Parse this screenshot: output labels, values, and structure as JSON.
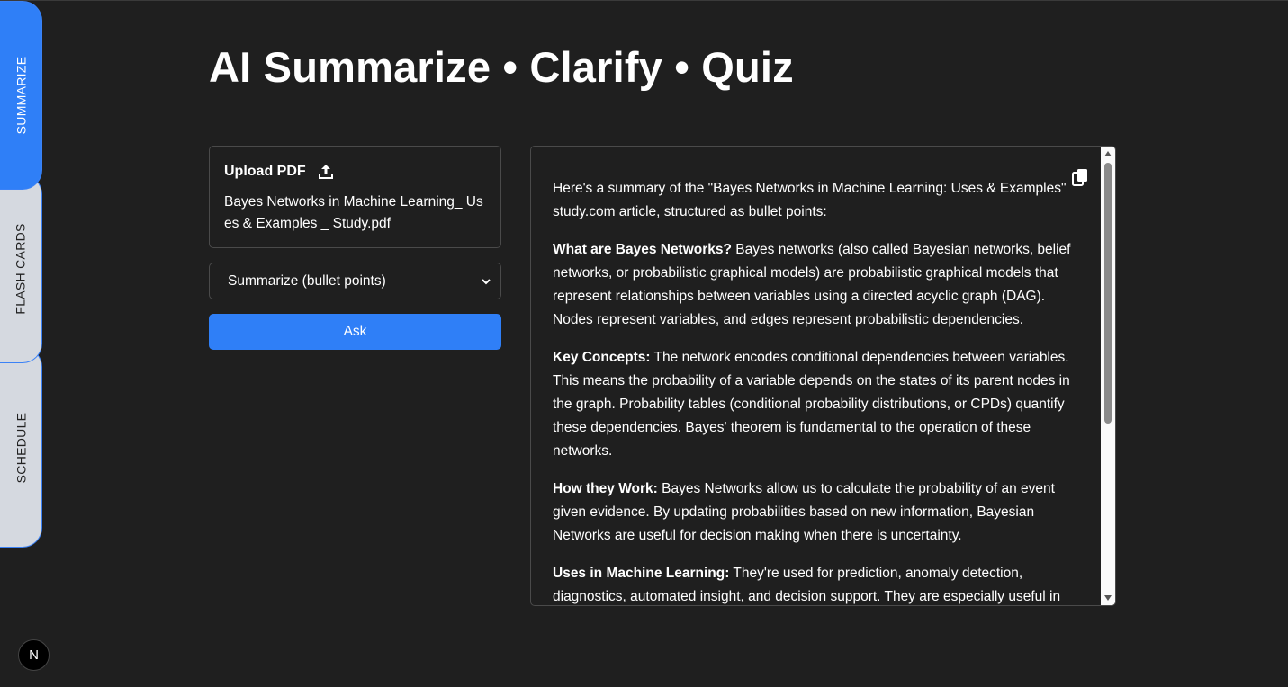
{
  "tabs": [
    {
      "label": "SUMMARIZE",
      "active": true
    },
    {
      "label": "FLASH CARDS",
      "active": false
    },
    {
      "label": "SCHEDULE",
      "active": false
    }
  ],
  "page_title": "AI Summarize • Clarify • Quiz",
  "upload": {
    "label": "Upload PDF",
    "icon": "upload-icon",
    "filename": "Bayes Networks in Machine Learning_ Uses & Examples _ Study.pdf"
  },
  "mode_select": {
    "selected": "Summarize (bullet points)"
  },
  "ask_button": "Ask",
  "output": {
    "intro": "Here's a summary of the \"Bayes Networks in Machine Learning: Uses & Examples\" study.com article, structured as bullet points:",
    "sections": [
      {
        "heading": "What are Bayes Networks?",
        "text": " Bayes networks (also called Bayesian networks, belief networks, or probabilistic graphical models) are probabilistic graphical models that represent relationships between variables using a directed acyclic graph (DAG). Nodes represent variables, and edges represent probabilistic dependencies."
      },
      {
        "heading": "Key Concepts:",
        "text": " The network encodes conditional dependencies between variables. This means the probability of a variable depends on the states of its parent nodes in the graph. Probability tables (conditional probability distributions, or CPDs) quantify these dependencies. Bayes' theorem is fundamental to the operation of these networks."
      },
      {
        "heading": "How they Work:",
        "text": " Bayes Networks allow us to calculate the probability of an event given evidence. By updating probabilities based on new information, Bayesian Networks are useful for decision making when there is uncertainty."
      },
      {
        "heading": "Uses in Machine Learning:",
        "text": " They're used for prediction, anomaly detection, diagnostics, automated insight, and decision support. They are especially useful in"
      }
    ]
  },
  "badge": "N",
  "colors": {
    "accent": "#2f7ff7",
    "background": "#1f1f1f",
    "inactive_tab": "#d5d9e0"
  }
}
